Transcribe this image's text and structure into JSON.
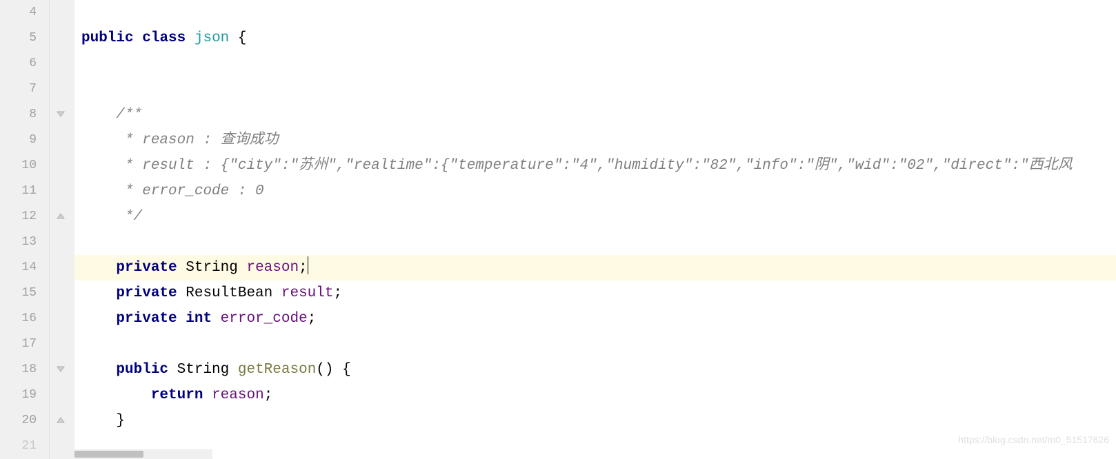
{
  "lines": {
    "start": 4,
    "end": 21,
    "numbers": [
      "4",
      "5",
      "6",
      "7",
      "8",
      "9",
      "10",
      "11",
      "12",
      "13",
      "14",
      "15",
      "16",
      "17",
      "18",
      "19",
      "20",
      "21"
    ]
  },
  "code": {
    "line5": {
      "kw_public": "public",
      "kw_class": "class",
      "classname": "json",
      "brace": " {"
    },
    "line8": {
      "comment": "/**"
    },
    "line9": {
      "comment": " * reason : 查询成功"
    },
    "line10": {
      "comment": " * result : {\"city\":\"苏州\",\"realtime\":{\"temperature\":\"4\",\"humidity\":\"82\",\"info\":\"阴\",\"wid\":\"02\",\"direct\":\"西北风"
    },
    "line11": {
      "comment": " * error_code : 0"
    },
    "line12": {
      "comment": " */"
    },
    "line14": {
      "kw_private": "private",
      "type": " String ",
      "field": "reason",
      "semi": ";"
    },
    "line15": {
      "kw_private": "private",
      "type": " ResultBean ",
      "field": "result",
      "semi": ";"
    },
    "line16": {
      "kw_private": "private",
      "kw_int": "int",
      "field": "error_code",
      "semi": ";"
    },
    "line18": {
      "kw_public": "public",
      "type": " String ",
      "method": "getReason",
      "rest": "() {"
    },
    "line19": {
      "kw_return": "return",
      "field": "reason",
      "semi": ";"
    },
    "line20": {
      "brace": "}"
    }
  },
  "highlighted_line": 14,
  "watermark": "https://blog.csdn.net/m0_51517626"
}
